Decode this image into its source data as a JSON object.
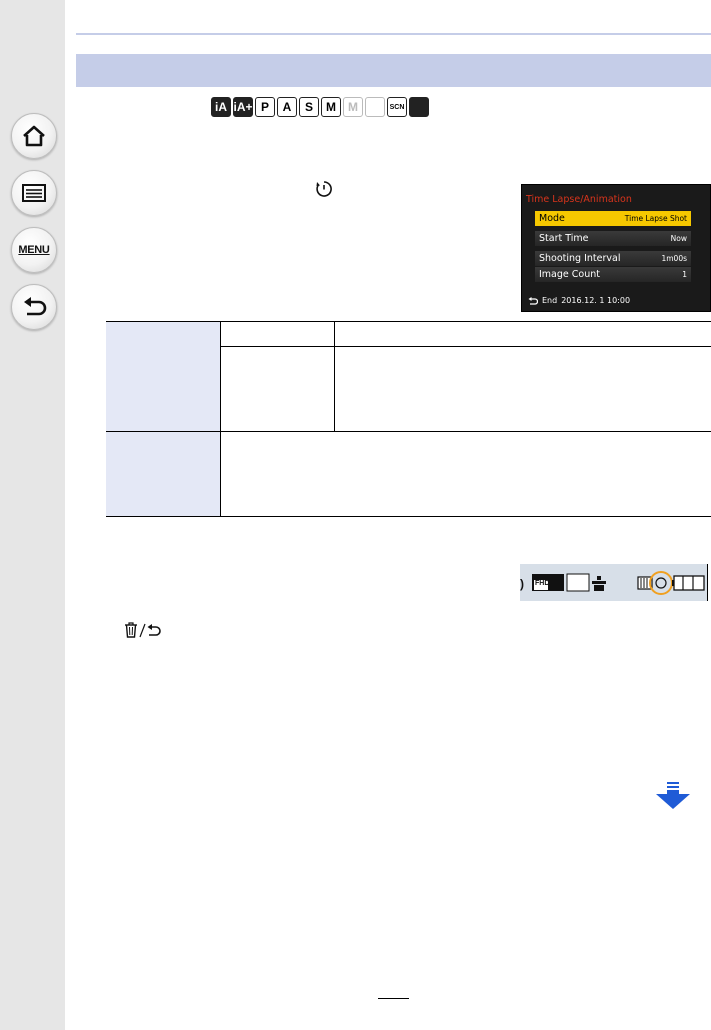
{
  "sidebar": {
    "menu_label": "MENU"
  },
  "mode_icons": [
    {
      "name": "intelligent-auto-icon",
      "text": "iA",
      "style": "dark"
    },
    {
      "name": "intelligent-auto-plus-icon",
      "text": "iA+",
      "style": "dark"
    },
    {
      "name": "program-mode-icon",
      "text": "P",
      "style": "normal"
    },
    {
      "name": "aperture-priority-icon",
      "text": "A",
      "style": "normal"
    },
    {
      "name": "shutter-priority-icon",
      "text": "S",
      "style": "normal"
    },
    {
      "name": "manual-mode-icon",
      "text": "M",
      "style": "normal"
    },
    {
      "name": "creative-video-icon",
      "text": "M",
      "style": "faint"
    },
    {
      "name": "panorama-icon",
      "text": "",
      "style": "faint"
    },
    {
      "name": "scene-mode-icon",
      "text": "SCN",
      "style": "small"
    },
    {
      "name": "creative-control-icon",
      "text": "",
      "style": "dark"
    }
  ],
  "camera_screen": {
    "title": "Time Lapse/Animation",
    "rows": [
      {
        "label": "Mode",
        "value": "Time Lapse Shot",
        "selected": true
      },
      {
        "label": "Start Time",
        "value": "Now",
        "selected": false
      },
      {
        "label": "Shooting Interval",
        "value": "1m00s",
        "selected": false
      },
      {
        "label": "Image Count",
        "value": "1",
        "selected": false
      }
    ],
    "footer_label": "End",
    "footer_datetime": "2016.12. 1 10:00",
    "colors": {
      "title": "#d8341c",
      "selected": "#f6c800",
      "background": "#1a1a1a"
    }
  },
  "status_screen": {
    "fhd_label": "FHD",
    "highlight_color": "#f0a020"
  },
  "colors": {
    "section_bar": "#c5cde8",
    "table_shade": "#e4e8f6",
    "sidebar": "#e6e6e6",
    "nav_arrow": "#1f5bd6"
  }
}
